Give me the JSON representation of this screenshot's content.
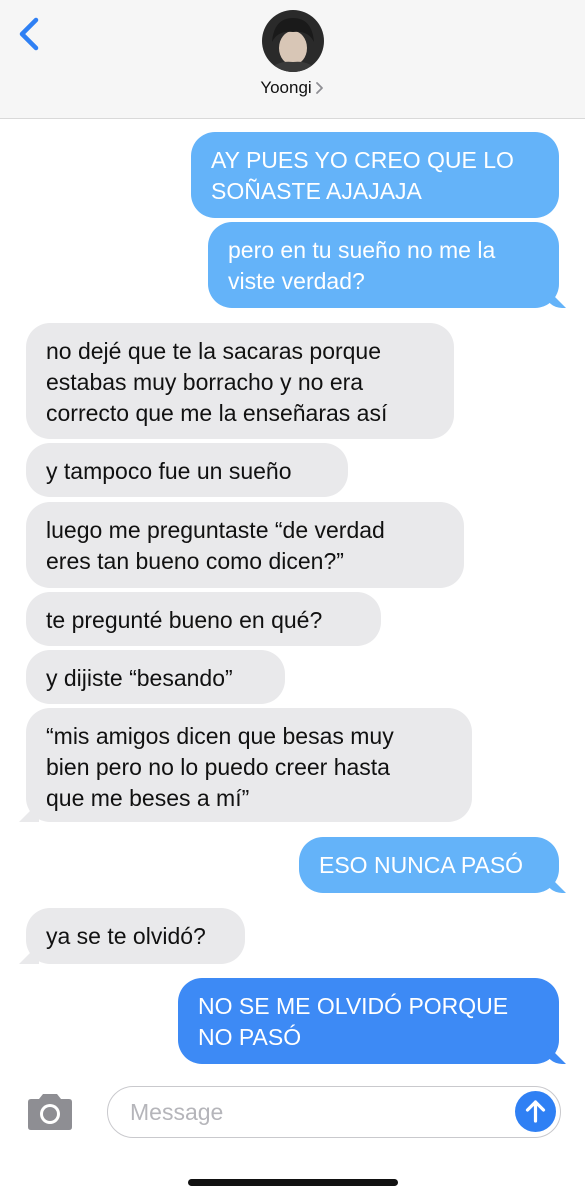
{
  "header": {
    "contact_name": "Yoongi"
  },
  "messages": [
    {
      "side": "sent",
      "text": "AY PUES YO CREO QUE LO\nSOÑASTE AJAJAJA"
    },
    {
      "side": "sent",
      "text": "pero en tu sueño no me la\nviste verdad?"
    },
    {
      "side": "received",
      "text": "no dejé que te la sacaras porque\nestabas muy borracho y no era\ncorrecto que me la enseñaras así"
    },
    {
      "side": "received",
      "text": "y tampoco fue un sueño"
    },
    {
      "side": "received",
      "text": "luego me preguntaste “de verdad\neres tan bueno como dicen?”"
    },
    {
      "side": "received",
      "text": "te pregunté bueno en qué?"
    },
    {
      "side": "received",
      "text": "y dijiste “besando”"
    },
    {
      "side": "received",
      "text": "“mis amigos dicen que besas muy\nbien pero no lo puedo creer hasta\nque me beses a mí”"
    },
    {
      "side": "sent",
      "text": "ESO NUNCA PASÓ"
    },
    {
      "side": "received",
      "text": "ya se te olvidó?"
    },
    {
      "side": "sent",
      "text": "NO SE ME OLVIDÓ PORQUE\nNO PASÓ"
    }
  ],
  "composer": {
    "placeholder": "Message"
  },
  "colors": {
    "sent_light": "#64b3f9",
    "sent_dark": "#3d8af5",
    "received": "#e9e9eb",
    "accent": "#2f80f4"
  }
}
